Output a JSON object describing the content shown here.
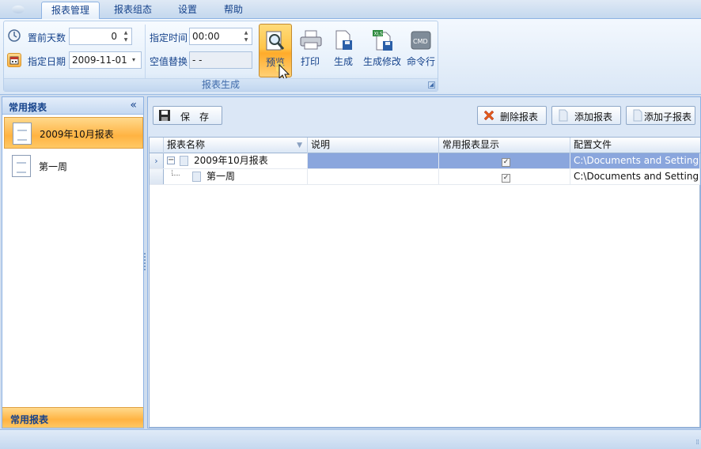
{
  "ribbon": {
    "tabs": [
      "报表管理",
      "报表组态",
      "设置",
      "帮助"
    ],
    "active_tab": "报表管理",
    "group_caption": "报表生成",
    "fields": {
      "days_before_label": "置前天数",
      "days_before_value": "0",
      "date_label": "指定日期",
      "date_value": "2009-11-01",
      "time_label": "指定时间",
      "time_value": "00:00",
      "null_replace_label": "空值替换",
      "null_replace_value": "- -"
    },
    "buttons": {
      "preview": "预览",
      "print": "打印",
      "generate": "生成",
      "generate_edit": "生成修改",
      "cmd": "命令行",
      "cmd_icon_text": "CMD",
      "xls_icon_text": "XLS"
    }
  },
  "left_panel": {
    "title": "常用报表",
    "collapse_glyph": "«",
    "items": [
      "2009年10月报表",
      "第一周"
    ],
    "selected": "2009年10月报表",
    "footer": "常用报表"
  },
  "toolbar": {
    "save": "保　存",
    "delete": "删除报表",
    "add": "添加报表",
    "add_child": "添加子报表"
  },
  "grid": {
    "columns": [
      "报表名称",
      "说明",
      "常用报表显示",
      "配置文件"
    ],
    "rows": [
      {
        "name": "2009年10月报表",
        "desc": "",
        "show": true,
        "config": "C:\\Documents and Setting...",
        "level": 0,
        "expanded": true
      },
      {
        "name": "第一周",
        "desc": "",
        "show": true,
        "config": "C:\\Documents and Setting...",
        "level": 1
      }
    ]
  },
  "colors": {
    "accent_orange": "#ffb342",
    "selected_row": "#8aa6dd",
    "ribbon_text": "#15428b"
  }
}
